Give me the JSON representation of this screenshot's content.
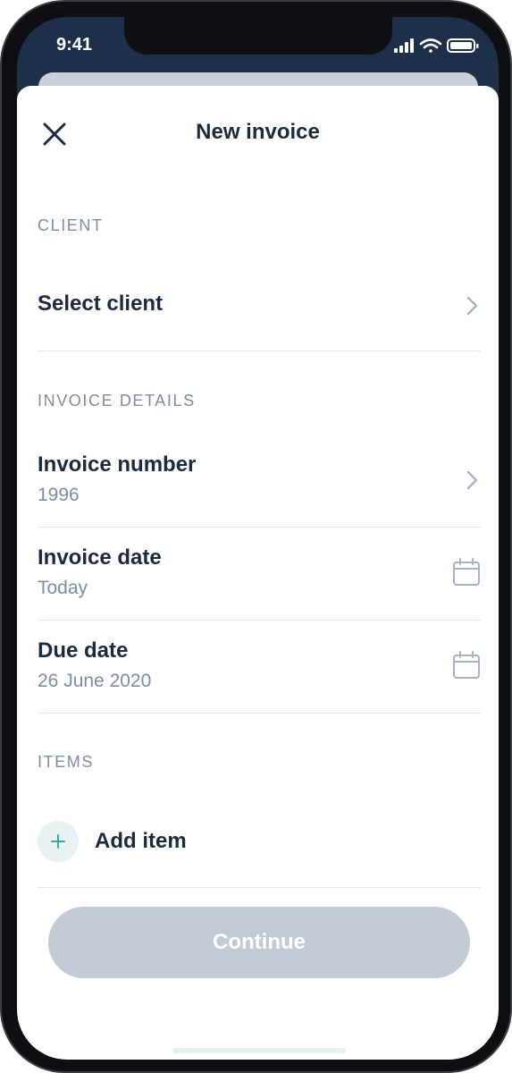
{
  "status_bar": {
    "time": "9:41"
  },
  "header": {
    "title": "New invoice",
    "close_icon": "close-icon"
  },
  "client": {
    "section_label": "CLIENT",
    "select_label": "Select client"
  },
  "invoice_details": {
    "section_label": "INVOICE DETAILS",
    "number": {
      "label": "Invoice number",
      "value": "1996"
    },
    "date": {
      "label": "Invoice date",
      "value": "Today"
    },
    "due_date": {
      "label": "Due date",
      "value": "26 June 2020"
    }
  },
  "items": {
    "section_label": "ITEMS",
    "add_label": "Add item"
  },
  "footer": {
    "continue_label": "Continue"
  },
  "colors": {
    "header_bg": "#1e2f4a",
    "text_primary": "#1b2a3f",
    "text_secondary": "#7d8da3",
    "accent": "#3aa6b0",
    "button_disabled": "#c2cad3"
  }
}
